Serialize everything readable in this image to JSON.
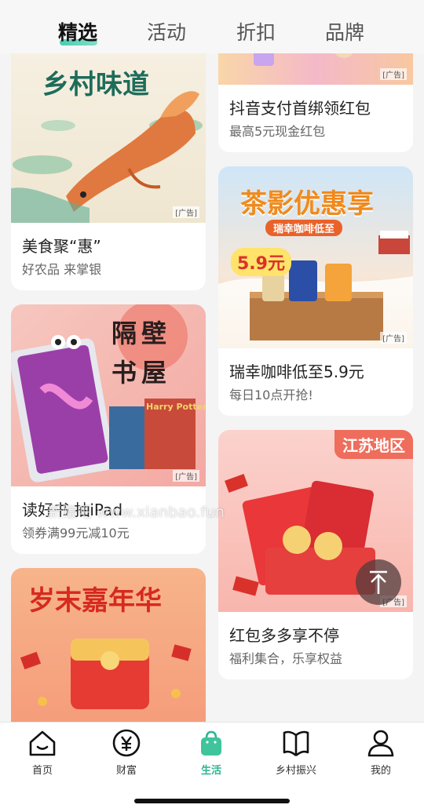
{
  "tabs": [
    {
      "label": "精选",
      "active": true
    },
    {
      "label": "活动",
      "active": false
    },
    {
      "label": "折扣",
      "active": false
    },
    {
      "label": "品牌",
      "active": false
    }
  ],
  "ad_label": "[广告]",
  "cards": {
    "food": {
      "banner": "乡村味道",
      "title": "美食聚“惠”",
      "subtitle": "好农品 来掌银"
    },
    "douyin": {
      "title": "抖音支付首绑领红包",
      "subtitle": "最高5元现金红包"
    },
    "luckin": {
      "banner": "茶影优惠享",
      "banner_sub": "瑞幸咖啡低至",
      "price": "5.9元",
      "title": "瑞幸咖啡低至5.9元",
      "subtitle": "每日10点开抢!"
    },
    "ipad": {
      "banner_1": "隔壁",
      "banner_2": "书屋",
      "book": "Harry Potter",
      "title": "读好书 抽iPad",
      "subtitle": "领券满99元减10元"
    },
    "redpacket": {
      "region": "江苏地区",
      "title": "红包多多享不停",
      "subtitle": "福利集合，乐享权益"
    },
    "carnival": {
      "banner": "岁末嘉年华"
    }
  },
  "watermark": "新赚吧 www.xianbao.fun",
  "bottom_nav": [
    {
      "label": "首页",
      "icon": "home-icon",
      "active": false
    },
    {
      "label": "财富",
      "icon": "yuan-icon",
      "active": false
    },
    {
      "label": "生活",
      "icon": "shopping-bag-icon",
      "active": true
    },
    {
      "label": "乡村振兴",
      "icon": "book-icon",
      "active": false
    },
    {
      "label": "我的",
      "icon": "user-icon",
      "active": false
    }
  ],
  "colors": {
    "accent": "#2bb58f",
    "tab_underline": "#4ecbb0"
  }
}
